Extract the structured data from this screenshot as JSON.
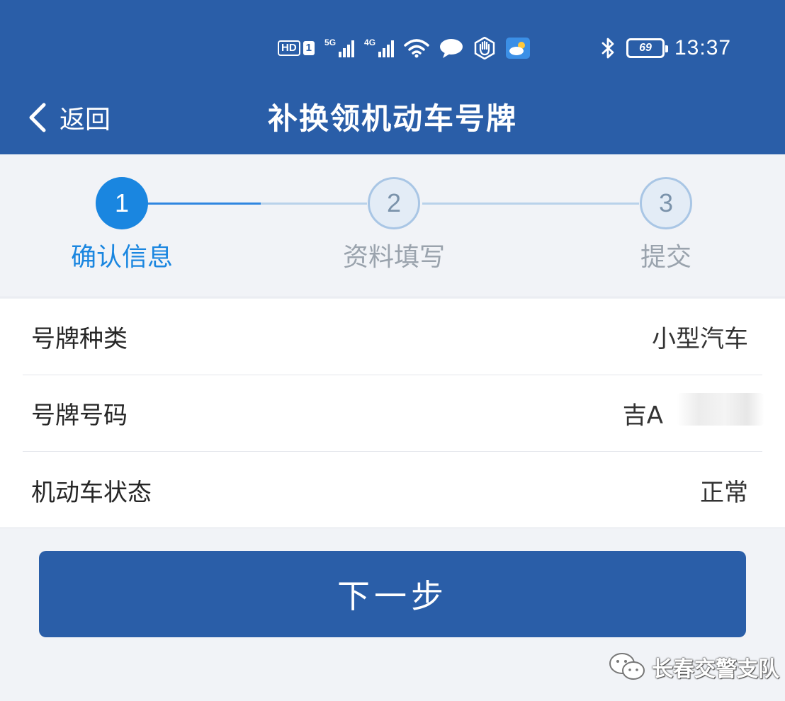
{
  "status_bar": {
    "hd_label": "HD",
    "sim1_label": "1",
    "net1_label": "5G",
    "net2_label": "4G",
    "battery": "69",
    "time": "13:37",
    "icons": [
      "hd-icon",
      "signal-5g-icon",
      "signal-4g-icon",
      "wifi-icon",
      "chat-icon",
      "hand-icon",
      "weather-icon",
      "bluetooth-icon",
      "battery-icon"
    ]
  },
  "header": {
    "back_label": "返回",
    "title": "补换领机动车号牌"
  },
  "stepper": {
    "steps": [
      {
        "number": "1",
        "label": "确认信息",
        "state": "active"
      },
      {
        "number": "2",
        "label": "资料填写",
        "state": "pending"
      },
      {
        "number": "3",
        "label": "提交",
        "state": "pending"
      }
    ]
  },
  "info": {
    "rows": [
      {
        "label": "号牌种类",
        "value": "小型汽车"
      },
      {
        "label": "号牌号码",
        "value": "吉A"
      },
      {
        "label": "机动车状态",
        "value": "正常"
      }
    ]
  },
  "actions": {
    "next_label": "下一步"
  },
  "watermark": {
    "text": "长春交警支队"
  },
  "colors": {
    "brand": "#2a5ea8",
    "accent": "#1a86e0",
    "page_bg": "#f1f3f7"
  }
}
